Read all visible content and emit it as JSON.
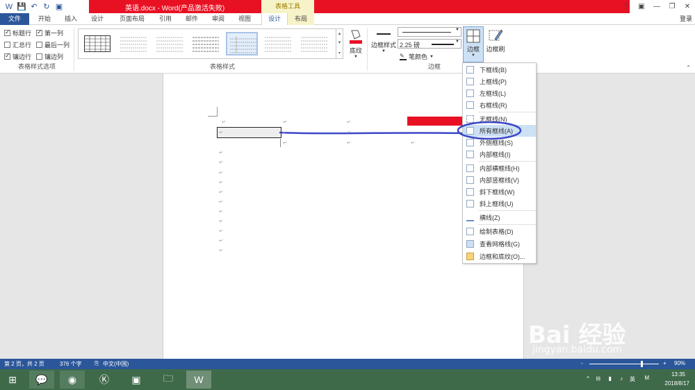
{
  "titlebar": {
    "doc_title": "英语.docx - Word(产品激活失败)",
    "context_tools": "表格工具",
    "help": "?",
    "minimize": "—",
    "restore": "❐",
    "close": "✕"
  },
  "tabs": {
    "file": "文件",
    "home": "开始",
    "insert": "插入",
    "design": "设计",
    "layout": "页面布局",
    "references": "引用",
    "mailings": "邮件",
    "review": "审阅",
    "view": "视图",
    "table_design": "设计",
    "table_layout": "布局",
    "login": "登录"
  },
  "ribbon": {
    "options": {
      "header_row": "标题行",
      "first_col": "第一列",
      "total_row": "汇总行",
      "last_col": "最后一列",
      "banded_rows": "镶边行",
      "banded_cols": "镶边列",
      "group_label": "表格样式选项"
    },
    "styles_group": "表格样式",
    "shading": "底纹",
    "border_styles": "边框样式",
    "line_weight": "2.25 磅",
    "pen_color": "笔颜色",
    "borders_btn": "边框",
    "border_painter": "边框刷",
    "borders_group": "边框"
  },
  "border_menu": {
    "items": [
      "下框线(B)",
      "上框线(P)",
      "左框线(L)",
      "右框线(R)",
      "无框线(N)",
      "所有框线(A)",
      "外侧框线(S)",
      "内部框线(I)",
      "内部横框线(H)",
      "内部竖框线(V)",
      "斜下框线(W)",
      "斜上框线(U)",
      "横线(Z)",
      "绘制表格(D)",
      "查看网格线(G)",
      "边框和底纹(O)..."
    ],
    "highlighted_index": 5
  },
  "statusbar": {
    "page": "第 2 页，共 2 页",
    "words": "376 个字",
    "lang": "中文(中国)",
    "zoom": "90%",
    "zoom_minus": "-",
    "zoom_plus": "+"
  },
  "taskbar": {
    "ime": "英",
    "time": "13:35",
    "date": "2018/8/17"
  },
  "watermark": {
    "brand": "Bai 经验",
    "url": "jingyan.baidu.com"
  },
  "colors": {
    "word_blue": "#2b579a",
    "title_red": "#e81123",
    "context_yellow": "#f7f3c8",
    "highlight": "#cde1f5",
    "annotation_blue": "#3a47c8"
  }
}
